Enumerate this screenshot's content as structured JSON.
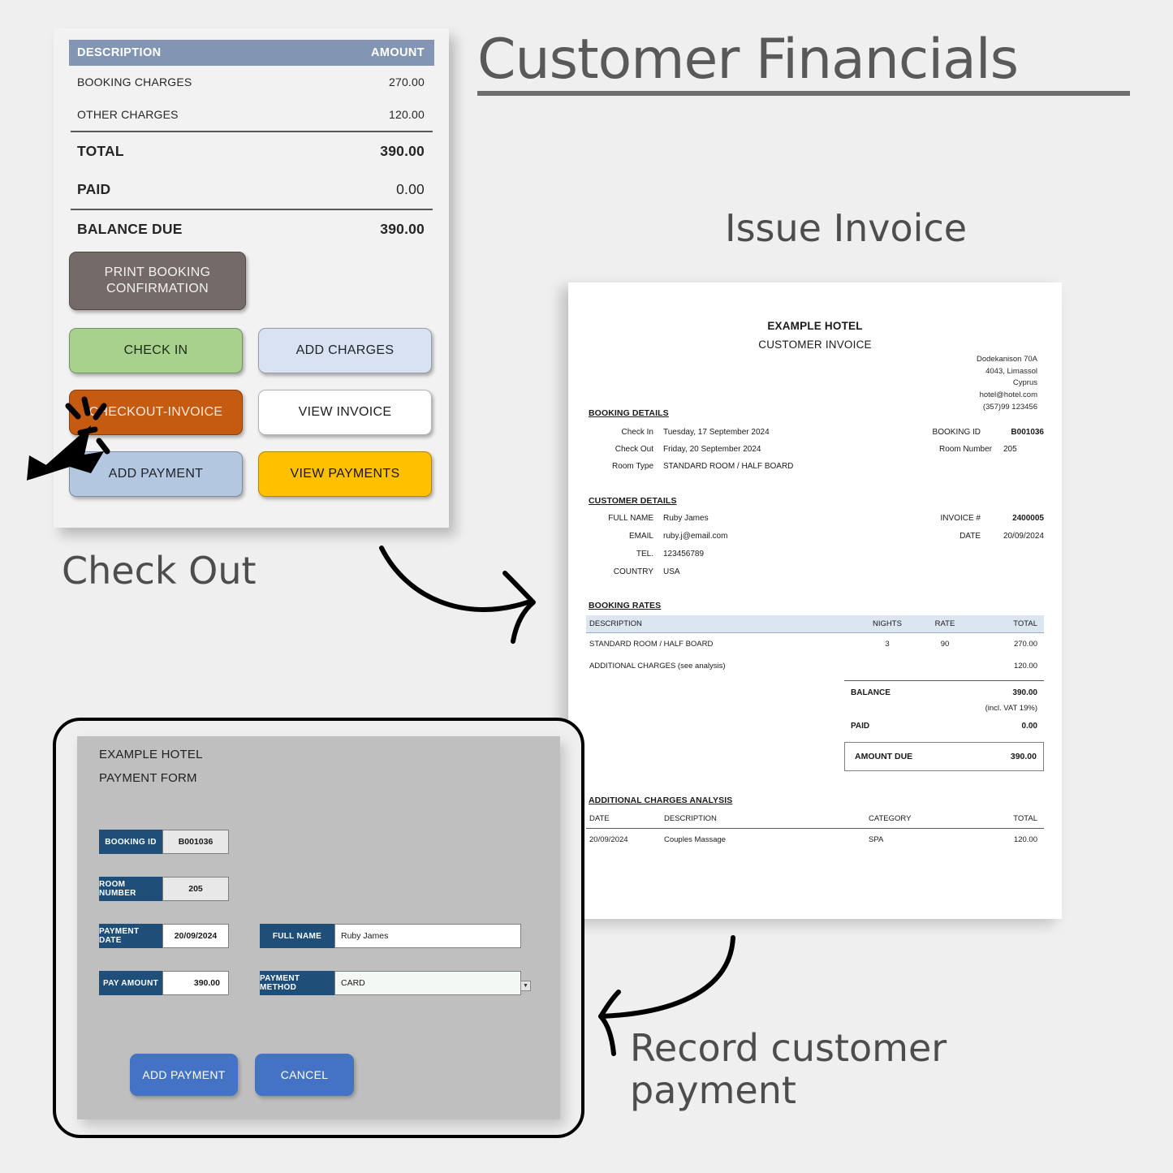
{
  "page": {
    "title": "Customer Financials",
    "background_color": "#efefef"
  },
  "annotations": {
    "issue_invoice": "Issue Invoice",
    "check_out": "Check Out",
    "record_customer_payment": "Record customer payment"
  },
  "financials_card": {
    "table": {
      "header": {
        "description": "DESCRIPTION",
        "amount": "AMOUNT"
      },
      "header_color": "#8296b4",
      "rows": [
        {
          "label": "BOOKING CHARGES",
          "value": "270.00",
          "bold": false
        },
        {
          "label": "OTHER CHARGES",
          "value": "120.00",
          "bold": false
        },
        {
          "label": "TOTAL",
          "value": "390.00",
          "bold": true
        },
        {
          "label": "PAID",
          "value": "0.00",
          "bold": true
        },
        {
          "label": "BALANCE DUE",
          "value": "390.00",
          "bold": true
        }
      ]
    },
    "buttons": {
      "print_booking_confirmation": "PRINT BOOKING CONFIRMATION",
      "check_in": "CHECK IN",
      "add_charges": "ADD CHARGES",
      "checkout_invoice": "CHECKOUT-INVOICE",
      "view_invoice": "VIEW INVOICE",
      "add_payment": "ADD PAYMENT",
      "view_payments": "VIEW PAYMENTS"
    },
    "button_colors": {
      "print_booking_confirmation": "#746a68",
      "check_in": "#a9d18e",
      "add_charges": "#d9e2f3",
      "checkout_invoice": "#c55a11",
      "view_invoice": "#ffffff",
      "add_payment": "#b4c7e0",
      "view_payments": "#ffc000"
    }
  },
  "invoice": {
    "hotel_name": "EXAMPLE HOTEL",
    "doc_type": "CUSTOMER INVOICE",
    "address": {
      "line1": "Dodekanison 70A",
      "line2": "4043, Limassol",
      "line3": "Cyprus",
      "email": "hotel@hotel.com",
      "phone": "(357)99 123456"
    },
    "booking_details": {
      "heading": "BOOKING DETAILS",
      "check_in_label": "Check In",
      "check_in_value": "Tuesday, 17 September 2024",
      "check_out_label": "Check Out",
      "check_out_value": "Friday, 20 September 2024",
      "room_type_label": "Room Type",
      "room_type_value": "STANDARD ROOM / HALF BOARD",
      "booking_id_label": "BOOKING ID",
      "booking_id_value": "B001036",
      "room_number_label": "Room Number",
      "room_number_value": "205"
    },
    "customer_details": {
      "heading": "CUSTOMER DETAILS",
      "full_name_label": "FULL NAME",
      "full_name_value": "Ruby James",
      "email_label": "EMAIL",
      "email_value": "ruby.j@email.com",
      "tel_label": "TEL.",
      "tel_value": "123456789",
      "country_label": "COUNTRY",
      "country_value": "USA",
      "invoice_no_label": "INVOICE #",
      "invoice_no_value": "2400005",
      "date_label": "DATE",
      "date_value": "20/09/2024"
    },
    "booking_rates": {
      "heading": "BOOKING RATES",
      "header_color": "#dce6f1",
      "columns": {
        "description": "DESCRIPTION",
        "nights": "NIGHTS",
        "rate": "RATE",
        "total": "TOTAL"
      },
      "rows": [
        {
          "description": "STANDARD ROOM / HALF BOARD",
          "nights": "3",
          "rate": "90",
          "total": "270.00"
        },
        {
          "description": "ADDITIONAL CHARGES (see analysis)",
          "nights": "",
          "rate": "",
          "total": "120.00"
        }
      ]
    },
    "totals": {
      "balance_label": "BALANCE",
      "balance_value": "390.00",
      "vat_note": "(incl. VAT 19%)",
      "paid_label": "PAID",
      "paid_value": "0.00",
      "amount_due_label": "AMOUNT DUE",
      "amount_due_value": "390.00"
    },
    "charges_analysis": {
      "heading": "ADDITIONAL CHARGES ANALYSIS",
      "columns": {
        "date": "DATE",
        "description": "DESCRIPTION",
        "category": "CATEGORY",
        "total": "TOTAL"
      },
      "rows": [
        {
          "date": "20/09/2024",
          "description": "Couples Massage",
          "category": "SPA",
          "total": "120.00"
        }
      ]
    }
  },
  "payment_form": {
    "hotel_name": "EXAMPLE HOTEL",
    "title": "PAYMENT FORM",
    "fields": {
      "booking_id_label": "BOOKING ID",
      "booking_id_value": "B001036",
      "room_number_label": "ROOM NUMBER",
      "room_number_value": "205",
      "payment_date_label": "PAYMENT DATE",
      "payment_date_value": "20/09/2024",
      "pay_amount_label": "PAY AMOUNT",
      "pay_amount_value": "390.00",
      "full_name_label": "FULL NAME",
      "full_name_value": "Ruby James",
      "payment_method_label": "PAYMENT METHOD",
      "payment_method_value": "CARD"
    },
    "buttons": {
      "add_payment": "ADD PAYMENT",
      "cancel": "CANCEL"
    },
    "label_color": "#1f4e79",
    "button_color": "#4472c4"
  }
}
